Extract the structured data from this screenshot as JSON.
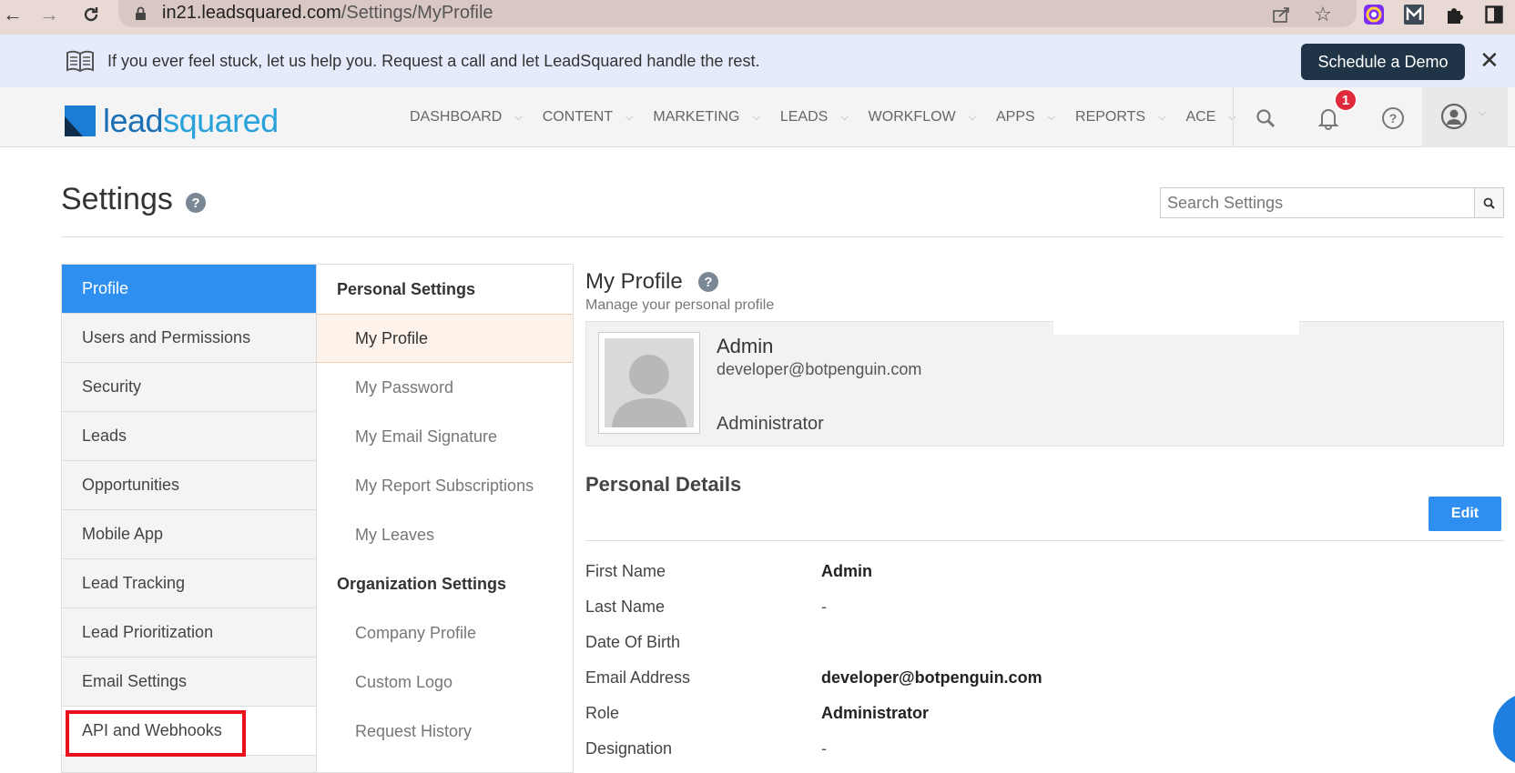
{
  "browser": {
    "url_host": "in21.leadsquared.com",
    "url_path": "/Settings/MyProfile"
  },
  "banner": {
    "message": "If you ever feel stuck, let us help you. Request a call and let LeadSquared handle the rest.",
    "demo_button": "Schedule a Demo",
    "close": "✕"
  },
  "header": {
    "logo_prefix": "lead",
    "logo_suffix": "squared",
    "nav": [
      "DASHBOARD",
      "CONTENT",
      "MARKETING",
      "LEADS",
      "WORKFLOW",
      "APPS",
      "REPORTS",
      "ACE"
    ],
    "notification_count": "1"
  },
  "settings": {
    "title": "Settings",
    "search_placeholder": "Search Settings"
  },
  "left_menu": {
    "items": [
      "Profile",
      "Users and Permissions",
      "Security",
      "Leads",
      "Opportunities",
      "Mobile App",
      "Lead Tracking",
      "Lead Prioritization",
      "Email Settings",
      "API and Webhooks"
    ]
  },
  "mid_menu": {
    "personal_heading": "Personal Settings",
    "personal_items": [
      "My Profile",
      "My Password",
      "My Email Signature",
      "My Report Subscriptions",
      "My Leaves"
    ],
    "org_heading": "Organization Settings",
    "org_items": [
      "Company Profile",
      "Custom Logo",
      "Request History"
    ]
  },
  "profile": {
    "title": "My Profile",
    "subtitle": "Manage your personal profile",
    "name": "Admin",
    "email": "developer@botpenguin.com",
    "role": "Administrator"
  },
  "details": {
    "title": "Personal Details",
    "edit_label": "Edit",
    "rows": [
      {
        "label": "First Name",
        "value": "Admin"
      },
      {
        "label": "Last Name",
        "value": "-"
      },
      {
        "label": "Date Of Birth",
        "value": ""
      },
      {
        "label": "Email Address",
        "value": "developer@botpenguin.com"
      },
      {
        "label": "Role",
        "value": "Administrator"
      },
      {
        "label": "Designation",
        "value": "-"
      }
    ]
  },
  "colors": {
    "accent": "#2e8ff0",
    "highlight": "#e8111b",
    "banner_bg": "#e5ebfb",
    "demo_btn": "#1f3447"
  }
}
